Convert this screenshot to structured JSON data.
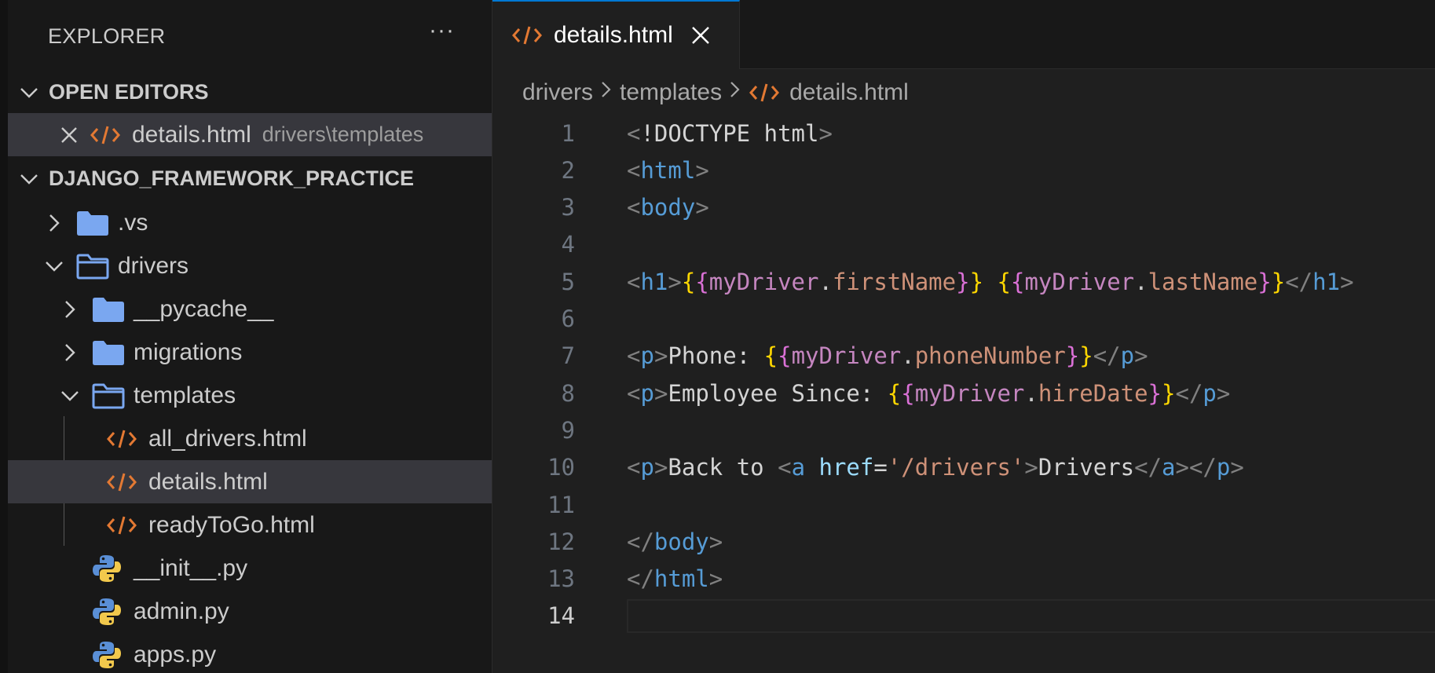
{
  "explorer": {
    "title": "EXPLORER",
    "more": "···",
    "open_editors_label": "OPEN EDITORS",
    "open_editor": {
      "name": "details.html",
      "path": "drivers\\templates"
    },
    "project_label": "DJANGO_FRAMEWORK_PRACTICE",
    "tree": [
      {
        "label": ".vs",
        "type": "folder",
        "expanded": false
      },
      {
        "label": "drivers",
        "type": "folder",
        "expanded": true
      },
      {
        "label": "__pycache__",
        "type": "folder",
        "expanded": false
      },
      {
        "label": "migrations",
        "type": "folder",
        "expanded": false
      },
      {
        "label": "templates",
        "type": "folder",
        "expanded": true
      },
      {
        "label": "all_drivers.html",
        "type": "html"
      },
      {
        "label": "details.html",
        "type": "html",
        "selected": true
      },
      {
        "label": "readyToGo.html",
        "type": "html"
      },
      {
        "label": "__init__.py",
        "type": "python"
      },
      {
        "label": "admin.py",
        "type": "python"
      },
      {
        "label": "apps.py",
        "type": "python"
      }
    ]
  },
  "tab": {
    "label": "details.html"
  },
  "breadcrumb": [
    "drivers",
    "templates",
    "details.html"
  ],
  "editor": {
    "current_line": 14,
    "line_numbers": [
      "1",
      "2",
      "3",
      "4",
      "5",
      "6",
      "7",
      "8",
      "9",
      "10",
      "11",
      "12",
      "13",
      "14"
    ],
    "lines": [
      [
        {
          "t": "<",
          "c": "br"
        },
        {
          "t": "!DOCTYPE html",
          "c": "txt"
        },
        {
          "t": ">",
          "c": "br"
        }
      ],
      [
        {
          "t": "<",
          "c": "br"
        },
        {
          "t": "html",
          "c": "tag"
        },
        {
          "t": ">",
          "c": "br"
        }
      ],
      [
        {
          "t": "<",
          "c": "br"
        },
        {
          "t": "body",
          "c": "tag"
        },
        {
          "t": ">",
          "c": "br"
        }
      ],
      [],
      [
        {
          "t": "<",
          "c": "br"
        },
        {
          "t": "h1",
          "c": "tag"
        },
        {
          "t": ">",
          "c": "br"
        },
        {
          "t": "{",
          "c": "b1"
        },
        {
          "t": "{",
          "c": "b2"
        },
        {
          "t": "myDriver",
          "c": "var"
        },
        {
          "t": ".",
          "c": "punc"
        },
        {
          "t": "firstName",
          "c": "prop"
        },
        {
          "t": "}",
          "c": "b2"
        },
        {
          "t": "}",
          "c": "b1"
        },
        {
          "t": " ",
          "c": "txt"
        },
        {
          "t": "{",
          "c": "b1"
        },
        {
          "t": "{",
          "c": "b2"
        },
        {
          "t": "myDriver",
          "c": "var"
        },
        {
          "t": ".",
          "c": "punc"
        },
        {
          "t": "lastName",
          "c": "prop"
        },
        {
          "t": "}",
          "c": "b2"
        },
        {
          "t": "}",
          "c": "b1"
        },
        {
          "t": "</",
          "c": "br"
        },
        {
          "t": "h1",
          "c": "tag"
        },
        {
          "t": ">",
          "c": "br"
        }
      ],
      [],
      [
        {
          "t": "<",
          "c": "br"
        },
        {
          "t": "p",
          "c": "tag"
        },
        {
          "t": ">",
          "c": "br"
        },
        {
          "t": "Phone: ",
          "c": "txt"
        },
        {
          "t": "{",
          "c": "b1"
        },
        {
          "t": "{",
          "c": "b2"
        },
        {
          "t": "myDriver",
          "c": "var"
        },
        {
          "t": ".",
          "c": "punc"
        },
        {
          "t": "phoneNumber",
          "c": "prop"
        },
        {
          "t": "}",
          "c": "b2"
        },
        {
          "t": "}",
          "c": "b1"
        },
        {
          "t": "</",
          "c": "br"
        },
        {
          "t": "p",
          "c": "tag"
        },
        {
          "t": ">",
          "c": "br"
        }
      ],
      [
        {
          "t": "<",
          "c": "br"
        },
        {
          "t": "p",
          "c": "tag"
        },
        {
          "t": ">",
          "c": "br"
        },
        {
          "t": "Employee Since: ",
          "c": "txt"
        },
        {
          "t": "{",
          "c": "b1"
        },
        {
          "t": "{",
          "c": "b2"
        },
        {
          "t": "myDriver",
          "c": "var"
        },
        {
          "t": ".",
          "c": "punc"
        },
        {
          "t": "hireDate",
          "c": "prop"
        },
        {
          "t": "}",
          "c": "b2"
        },
        {
          "t": "}",
          "c": "b1"
        },
        {
          "t": "</",
          "c": "br"
        },
        {
          "t": "p",
          "c": "tag"
        },
        {
          "t": ">",
          "c": "br"
        }
      ],
      [],
      [
        {
          "t": "<",
          "c": "br"
        },
        {
          "t": "p",
          "c": "tag"
        },
        {
          "t": ">",
          "c": "br"
        },
        {
          "t": "Back to ",
          "c": "txt"
        },
        {
          "t": "<",
          "c": "br"
        },
        {
          "t": "a",
          "c": "tag"
        },
        {
          "t": " ",
          "c": "txt"
        },
        {
          "t": "href",
          "c": "attr"
        },
        {
          "t": "=",
          "c": "txt"
        },
        {
          "t": "'/drivers'",
          "c": "str"
        },
        {
          "t": ">",
          "c": "br"
        },
        {
          "t": "Drivers",
          "c": "txt"
        },
        {
          "t": "</",
          "c": "br"
        },
        {
          "t": "a",
          "c": "tag"
        },
        {
          "t": ">",
          "c": "br"
        },
        {
          "t": "</",
          "c": "br"
        },
        {
          "t": "p",
          "c": "tag"
        },
        {
          "t": ">",
          "c": "br"
        }
      ],
      [],
      [
        {
          "t": "</",
          "c": "br"
        },
        {
          "t": "body",
          "c": "tag"
        },
        {
          "t": ">",
          "c": "br"
        }
      ],
      [
        {
          "t": "</",
          "c": "br"
        },
        {
          "t": "html",
          "c": "tag"
        },
        {
          "t": ">",
          "c": "br"
        }
      ],
      []
    ]
  }
}
